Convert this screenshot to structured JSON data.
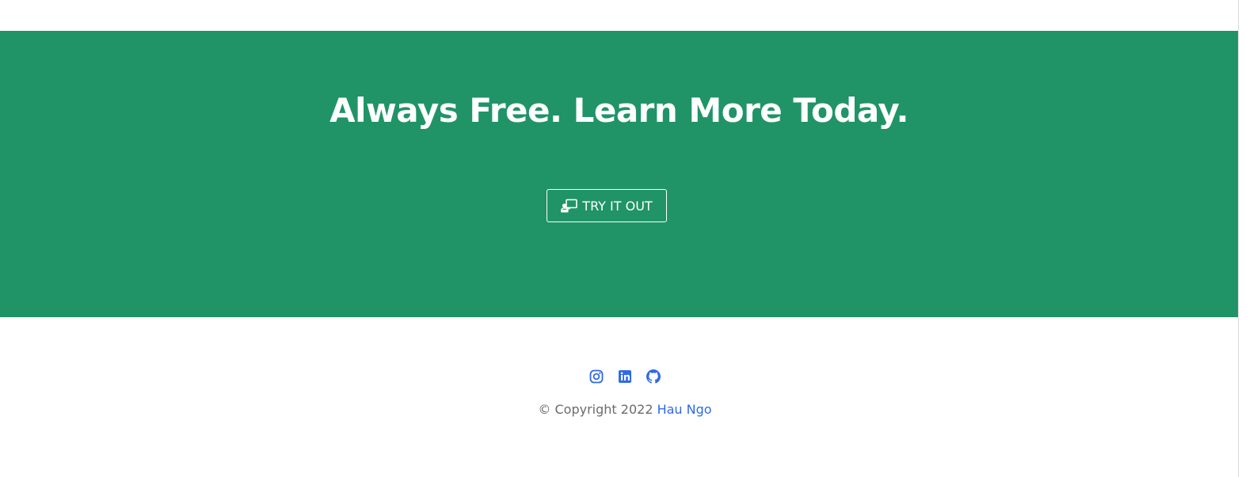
{
  "cta": {
    "heading": "Always Free. Learn More Today.",
    "button_label": "TRY IT OUT",
    "button_icon": "presentation-icon",
    "background_color": "#209467"
  },
  "footer": {
    "social_links": [
      {
        "name": "instagram",
        "icon": "instagram-icon"
      },
      {
        "name": "linkedin",
        "icon": "linkedin-icon"
      },
      {
        "name": "github",
        "icon": "github-icon"
      }
    ],
    "copyright_prefix": "© Copyright 2022",
    "author_name": "Hau Ngo",
    "link_color": "#2f6ae6"
  }
}
